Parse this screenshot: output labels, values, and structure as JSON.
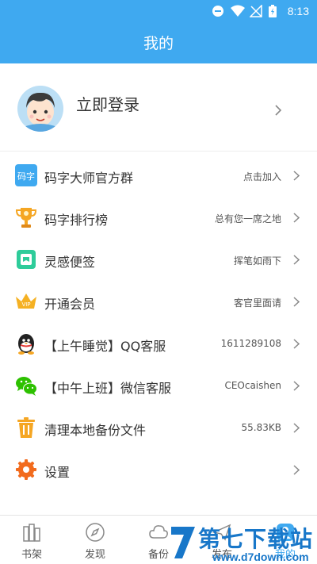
{
  "status_bar": {
    "time": "8:13"
  },
  "header": {
    "title": "我的"
  },
  "profile": {
    "login_label": "立即登录"
  },
  "menu": [
    {
      "label": "码字大师官方群",
      "value": "点击加入",
      "icon": "group-icon"
    },
    {
      "label": "码字排行榜",
      "value": "总有您一席之地",
      "icon": "trophy-icon"
    },
    {
      "label": "灵感便签",
      "value": "挥笔如雨下",
      "icon": "note-icon"
    },
    {
      "label": "开通会员",
      "value": "客官里面请",
      "icon": "vip-crown-icon"
    },
    {
      "label": "【上午睡觉】QQ客服",
      "value": "1611289108",
      "icon": "qq-icon"
    },
    {
      "label": "【中午上班】微信客服",
      "value": "CEOcaishen",
      "icon": "wechat-icon"
    },
    {
      "label": "清理本地备份文件",
      "value": "55.83KB",
      "icon": "trash-icon"
    },
    {
      "label": "设置",
      "value": "",
      "icon": "settings-icon"
    }
  ],
  "bottom_nav": [
    {
      "label": "书架",
      "icon": "bookshelf-icon"
    },
    {
      "label": "发现",
      "icon": "compass-icon"
    },
    {
      "label": "备份",
      "icon": "cloud-icon"
    },
    {
      "label": "发布",
      "icon": "publish-icon"
    },
    {
      "label": "我的",
      "icon": "profile-icon"
    }
  ],
  "watermark": {
    "title": "第七下载站",
    "url": "www.d7down.com"
  },
  "colors": {
    "accent": "#3fa9f0",
    "divider": "#eeeeee"
  }
}
